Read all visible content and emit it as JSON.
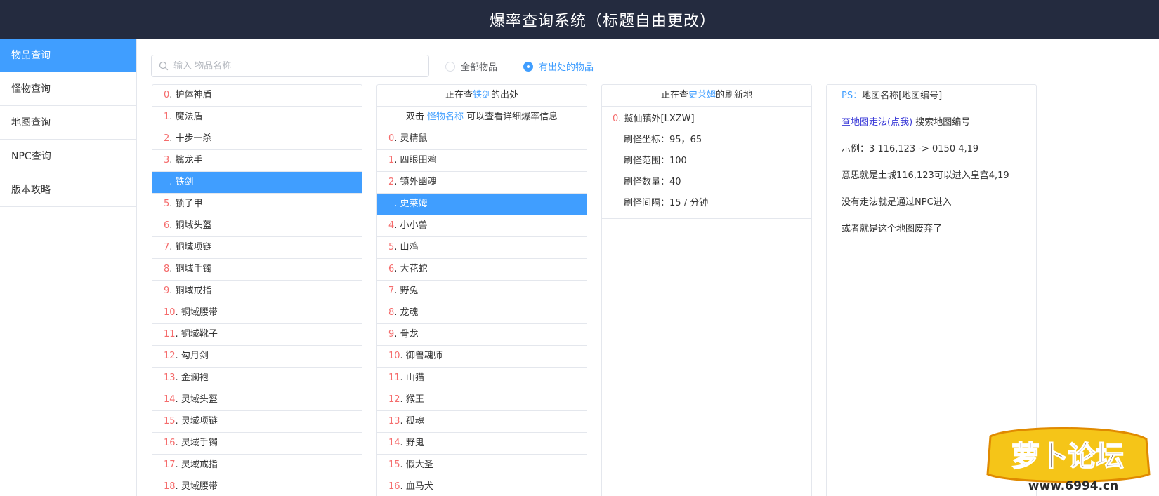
{
  "header": {
    "title": "爆率查询系统（标题自由更改）"
  },
  "colors": {
    "accent": "#409eff",
    "header_bg": "#242b3f",
    "index": "#f56c6c",
    "link": "#3a3ad8",
    "border": "#e4e7ed"
  },
  "sidebar": {
    "items": [
      {
        "label": "物品查询",
        "active": true
      },
      {
        "label": "怪物查询"
      },
      {
        "label": "地图查询"
      },
      {
        "label": "NPC查询"
      },
      {
        "label": "版本攻略"
      }
    ]
  },
  "search": {
    "placeholder": "输入 物品名称",
    "value": "",
    "icon": "search-icon"
  },
  "filters": {
    "all": "全部物品",
    "with_source": "有出处的物品",
    "selected": "with_source"
  },
  "items_panel": {
    "selected_index": 4,
    "items": [
      {
        "idx": "0",
        "name": "护体神盾"
      },
      {
        "idx": "1",
        "name": "魔法盾"
      },
      {
        "idx": "2",
        "name": "十步一杀"
      },
      {
        "idx": "3",
        "name": "擒龙手"
      },
      {
        "idx": "4",
        "name": "铁剑"
      },
      {
        "idx": "5",
        "name": "锁子甲"
      },
      {
        "idx": "6",
        "name": "铜域头盔"
      },
      {
        "idx": "7",
        "name": "铜域项链"
      },
      {
        "idx": "8",
        "name": "铜域手镯"
      },
      {
        "idx": "9",
        "name": "铜域戒指"
      },
      {
        "idx": "10",
        "name": "铜域腰带"
      },
      {
        "idx": "11",
        "name": "铜域靴子"
      },
      {
        "idx": "12",
        "name": "勾月剑"
      },
      {
        "idx": "13",
        "name": "金澜袍"
      },
      {
        "idx": "14",
        "name": "灵域头盔"
      },
      {
        "idx": "15",
        "name": "灵域项链"
      },
      {
        "idx": "16",
        "name": "灵域手镯"
      },
      {
        "idx": "17",
        "name": "灵域戒指"
      },
      {
        "idx": "18",
        "name": "灵域腰带"
      }
    ]
  },
  "monsters_panel": {
    "head_prefix": "正在查",
    "head_item": "铁剑",
    "head_suffix": "的出处",
    "hint_prefix": "双击",
    "hint_link": "怪物名称",
    "hint_suffix": "可以查看详细爆率信息",
    "selected_index": 3,
    "items": [
      {
        "idx": "0",
        "name": "灵精鼠"
      },
      {
        "idx": "1",
        "name": "四眼田鸡"
      },
      {
        "idx": "2",
        "name": "镇外幽魂"
      },
      {
        "idx": "3",
        "name": "史莱姆"
      },
      {
        "idx": "4",
        "name": "小小兽"
      },
      {
        "idx": "5",
        "name": "山鸡"
      },
      {
        "idx": "6",
        "name": "大花蛇"
      },
      {
        "idx": "7",
        "name": "野兔"
      },
      {
        "idx": "8",
        "name": "龙魂"
      },
      {
        "idx": "9",
        "name": "骨龙"
      },
      {
        "idx": "10",
        "name": "御兽魂师"
      },
      {
        "idx": "11",
        "name": "山猫"
      },
      {
        "idx": "12",
        "name": "猴王"
      },
      {
        "idx": "13",
        "name": "孤魂"
      },
      {
        "idx": "14",
        "name": "野鬼"
      },
      {
        "idx": "15",
        "name": "假大圣"
      },
      {
        "idx": "16",
        "name": "血马犬"
      }
    ]
  },
  "refresh_panel": {
    "head_prefix": "正在查",
    "head_monster": "史莱姆",
    "head_suffix": "的刷新地",
    "map_idx": "0",
    "map_name": "揽仙镇外[LXZW]",
    "props": [
      {
        "label": "刷怪坐标：",
        "value": "95，65"
      },
      {
        "label": "刷怪范围：",
        "value": "100"
      },
      {
        "label": "刷怪数量：",
        "value": "40"
      },
      {
        "label": "刷怪间隔：",
        "value": "15 / 分钟"
      }
    ]
  },
  "info_panel": {
    "ps_label": "PS：",
    "ps_text": "地图名称[地图编号]",
    "link": "查地图走法(点我)",
    "link_suffix": "搜索地图编号",
    "example": "示例：3 116,123 -> 0150 4,19",
    "meaning": "意思就是土城116,123可以进入皇宫4,19",
    "no_route": "没有走法就是通过NPC进入",
    "abandoned": "或者就是这个地图废弃了"
  },
  "watermark": {
    "text": "萝卜论坛",
    "url_text": "www.6994.cn"
  }
}
